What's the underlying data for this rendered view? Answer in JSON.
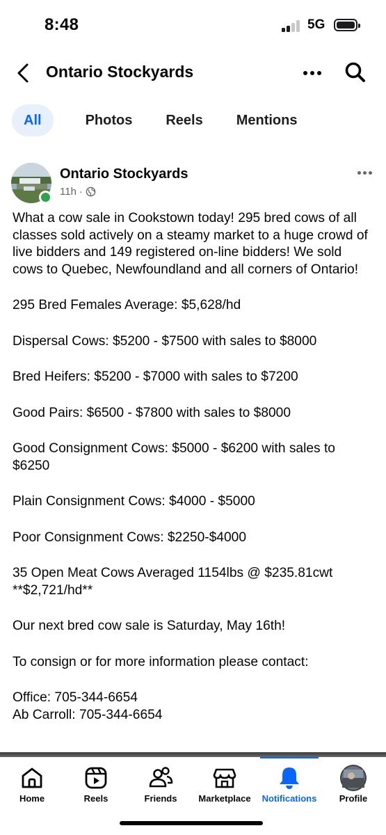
{
  "status": {
    "time": "8:48",
    "network": "5G"
  },
  "header": {
    "title": "Ontario Stockyards"
  },
  "tabs": [
    {
      "label": "All",
      "active": true
    },
    {
      "label": "Photos",
      "active": false
    },
    {
      "label": "Reels",
      "active": false
    },
    {
      "label": "Mentions",
      "active": false
    }
  ],
  "post": {
    "author": "Ontario Stockyards",
    "age": "11h",
    "separator": "·",
    "privacy_icon": "globe-icon",
    "paragraphs": [
      "What a cow sale in Cookstown today! 295 bred cows of all classes sold actively on a steamy market to a huge crowd of live bidders and 149 registered on-line bidders! We sold cows to Quebec, Newfoundland and all corners of Ontario!",
      "295 Bred Females Average: $5,628/hd",
      "Dispersal Cows: $5200 - $7500 with sales to $8000",
      "Bred Heifers: $5200 - $7000 with sales to $7200",
      "Good Pairs: $6500 - $7800 with sales to $8000",
      "Good Consignment Cows: $5000 - $6200 with sales to $6250",
      "Plain Consignment Cows: $4000 - $5000",
      "Poor Consignment Cows: $2250-$4000",
      "35 Open Meat Cows Averaged 1154lbs @ $235.81cwt **$2,721/hd**",
      "Our next bred cow sale is Saturday, May 16th!",
      "To consign or for more information please contact:",
      "Office: 705-344-6654",
      "Ab Carroll: 705-344-6654"
    ]
  },
  "bottom_nav": [
    {
      "label": "Home",
      "icon": "home-icon",
      "active": false
    },
    {
      "label": "Reels",
      "icon": "reels-icon",
      "active": false
    },
    {
      "label": "Friends",
      "icon": "friends-icon",
      "active": false
    },
    {
      "label": "Marketplace",
      "icon": "marketplace-icon",
      "active": false
    },
    {
      "label": "Notifications",
      "icon": "bell-icon",
      "active": true
    },
    {
      "label": "Profile",
      "icon": "profile-avatar",
      "active": false
    }
  ],
  "colors": {
    "accent": "#0866ff",
    "tab_active_bg": "#e7f0fc",
    "online": "#31a24c",
    "meta": "#65676b"
  }
}
